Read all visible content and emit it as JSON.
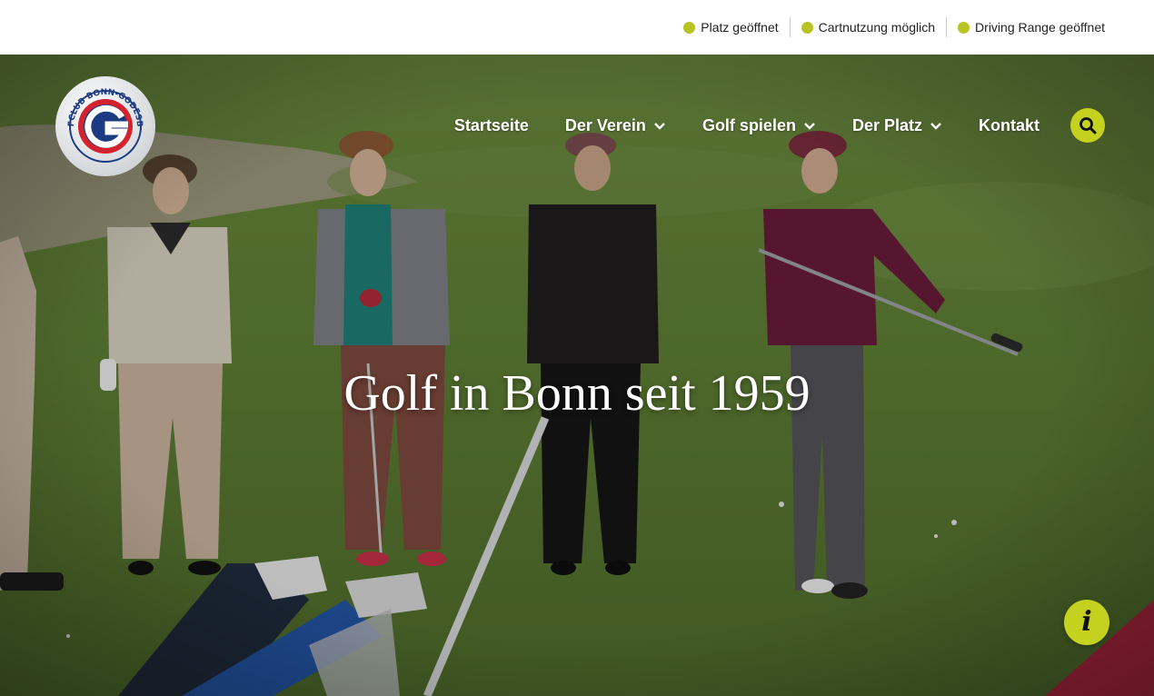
{
  "status": {
    "items": [
      {
        "label": "Platz geöffnet"
      },
      {
        "label": "Cartnutzung möglich"
      },
      {
        "label": "Driving Range geöffnet"
      }
    ],
    "dot_color": "#b8c424"
  },
  "logo": {
    "text": "GOLFCLUB BONN-GODESBERG",
    "letter": "G"
  },
  "nav": {
    "items": [
      {
        "label": "Startseite",
        "has_dropdown": false
      },
      {
        "label": "Der Verein",
        "has_dropdown": true
      },
      {
        "label": "Golf spielen",
        "has_dropdown": true
      },
      {
        "label": "Der Platz",
        "has_dropdown": true
      },
      {
        "label": "Kontakt",
        "has_dropdown": false
      }
    ],
    "search_icon": "search-icon"
  },
  "hero": {
    "headline": "Golf in Bonn seit 1959"
  },
  "info": {
    "icon": "info-icon",
    "glyph": "i"
  },
  "colors": {
    "accent": "#c4d11f",
    "grass": "#5b7a34",
    "text_dark": "#222222"
  }
}
